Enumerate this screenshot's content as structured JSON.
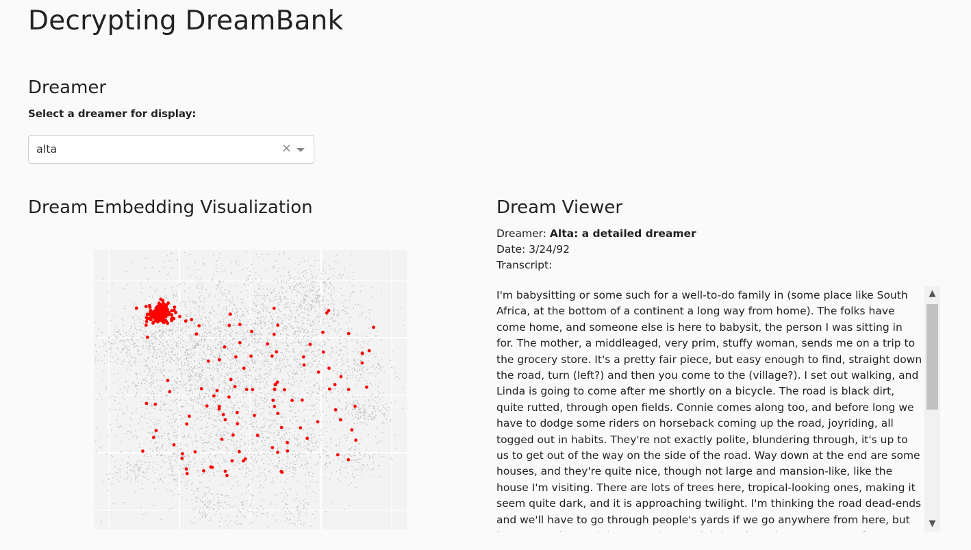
{
  "app": {
    "title": "Decrypting DreamBank"
  },
  "dreamer_section": {
    "heading": "Dreamer",
    "select_label": "Select a dreamer for display:",
    "select_value": "alta",
    "clear_glyph": "×"
  },
  "embedding_section": {
    "heading": "Dream Embedding Visualization",
    "colors": {
      "background": "#f3f3f3",
      "grid": "#ffffff",
      "all_dreams": "#9a9a9a",
      "selected": "#ff0000"
    }
  },
  "viewer": {
    "heading": "Dream Viewer",
    "dreamer_label": "Dreamer:",
    "dreamer_value": "Alta: a detailed dreamer",
    "date_label": "Date:",
    "date_value": "3/24/92",
    "transcript_label": "Transcript:",
    "transcript": "I'm babysitting or some such for a well-to-do family in (some place like South Africa, at the bottom of a continent a long way from home). The folks have come home, and someone else is here to babysit, the person I was sitting in for. The mother, a middleaged, very prim, stuffy woman, sends me on a trip to the grocery store. It's a pretty fair piece, but easy enough to find, straight down the road, turn (left?) and then you come to the (village?). I set out walking, and Linda is going to come after me shortly on a bicycle. The road is black dirt, quite rutted, through open fields. Connie comes along too, and before long we have to dodge some riders on horseback coming up the road, joyriding, all togged out in habits. They're not exactly polite, blundering through, it's up to us to get out of the way on the side of the road. Way down at the end are some houses, and they're quite nice, though not large and mansion-like, like the house I'm visiting. There are lots of trees here, tropical-looking ones, making it seem quite dark, and it is approaching twilight. I'm thinking the road dead-ends and we'll have to go through people's yards if we go anywhere from here, but by George the road does turn (we go right) and continues to a sort of country general store. Inside there's a counter with a proprietor, and shelves with goods on them."
  }
}
